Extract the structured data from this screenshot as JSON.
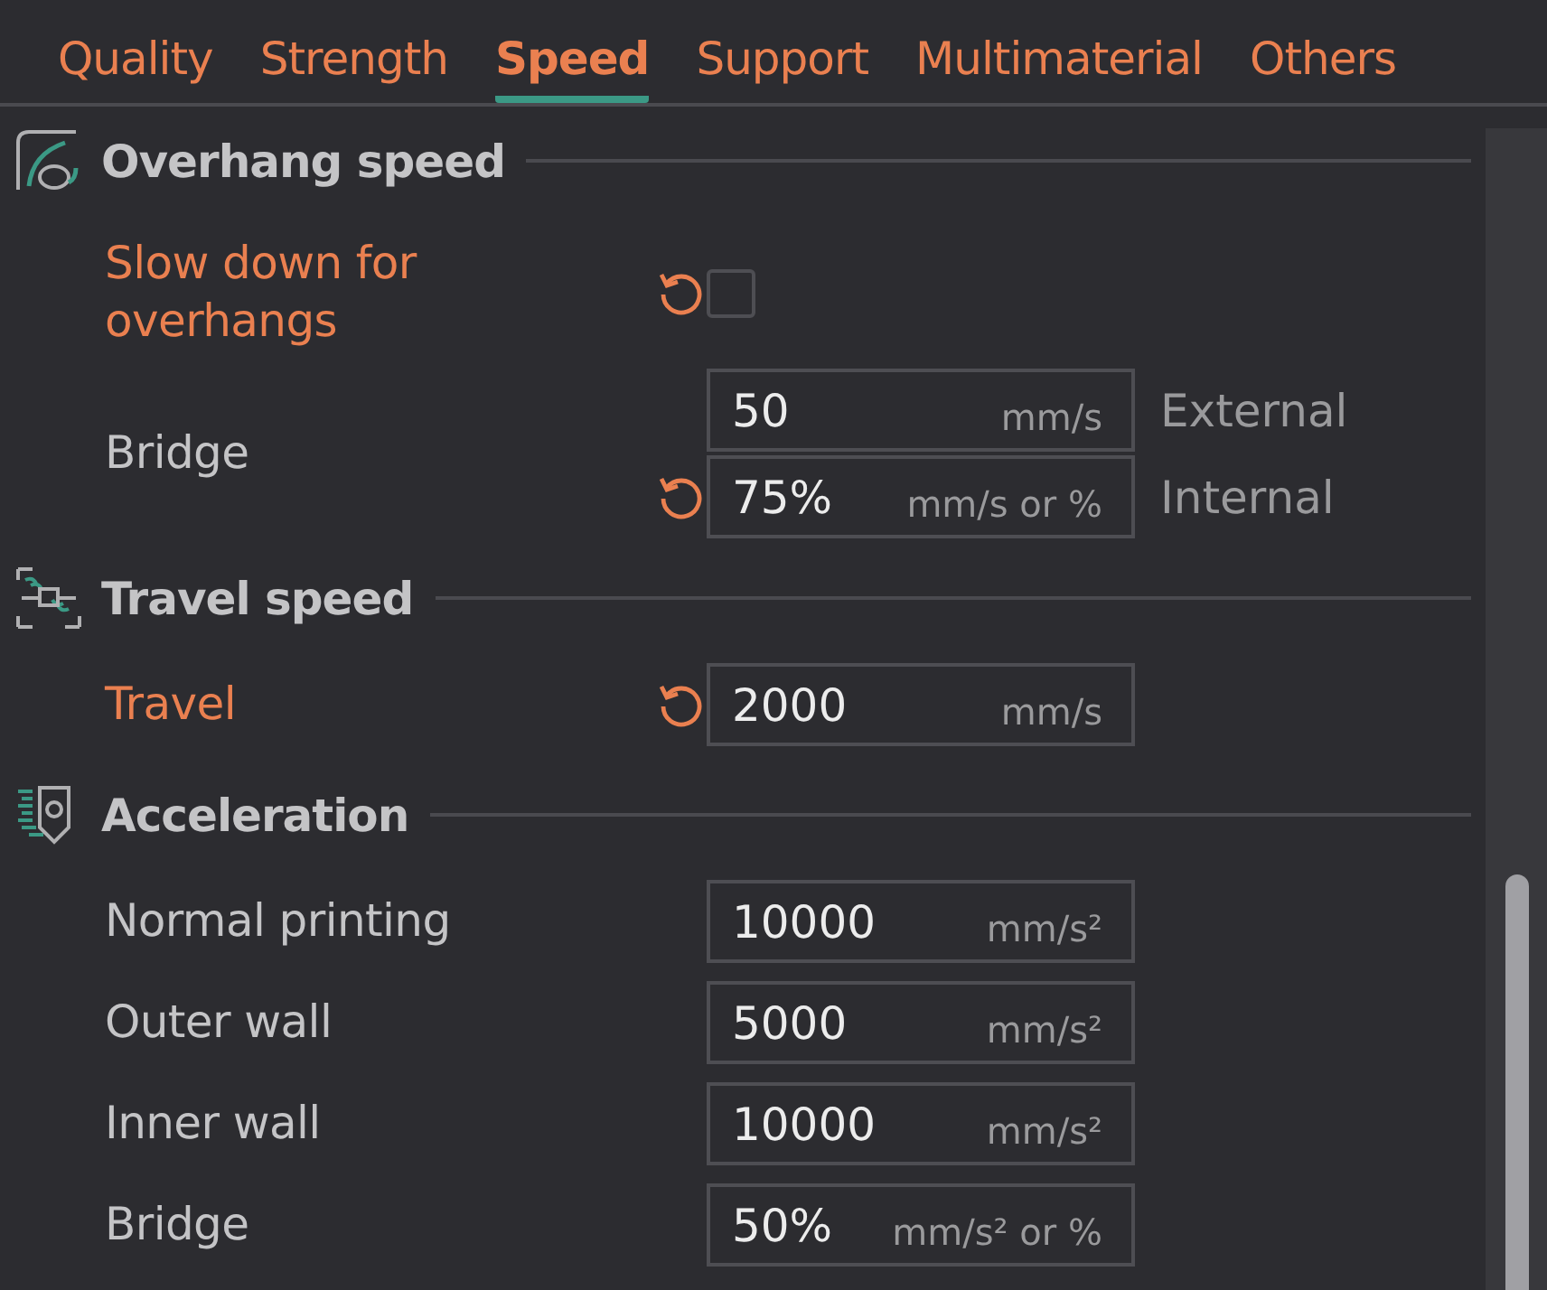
{
  "tabs": [
    {
      "label": "Quality",
      "selected": false
    },
    {
      "label": "Strength",
      "selected": false
    },
    {
      "label": "Speed",
      "selected": true
    },
    {
      "label": "Support",
      "selected": false
    },
    {
      "label": "Multimaterial",
      "selected": false
    },
    {
      "label": "Others",
      "selected": false
    }
  ],
  "sections": [
    {
      "title": "Overhang speed",
      "rows": [
        {
          "kind": "checkbox",
          "label": "Slow down for overhangs",
          "modified": true,
          "reset": true,
          "checked": false
        },
        {
          "kind": "inputs",
          "label": "Bridge",
          "modified": false,
          "fields": [
            {
              "value": "50",
              "unit": "mm/s",
              "side": "External",
              "reset": false
            },
            {
              "value": "75%",
              "unit": "mm/s or %",
              "side": "Internal",
              "reset": true
            }
          ]
        }
      ]
    },
    {
      "title": "Travel speed",
      "rows": [
        {
          "kind": "inputs",
          "label": "Travel",
          "modified": true,
          "fields": [
            {
              "value": "2000",
              "unit": "mm/s",
              "reset": true
            }
          ]
        }
      ]
    },
    {
      "title": "Acceleration",
      "rows": [
        {
          "kind": "inputs",
          "label": "Normal printing",
          "modified": false,
          "fields": [
            {
              "value": "10000",
              "unit": "mm/s²",
              "reset": false
            }
          ]
        },
        {
          "kind": "inputs",
          "label": "Outer wall",
          "modified": false,
          "fields": [
            {
              "value": "5000",
              "unit": "mm/s²",
              "reset": false
            }
          ]
        },
        {
          "kind": "inputs",
          "label": "Inner wall",
          "modified": false,
          "fields": [
            {
              "value": "10000",
              "unit": "mm/s²",
              "reset": false
            }
          ]
        },
        {
          "kind": "inputs",
          "label": "Bridge",
          "modified": false,
          "fields": [
            {
              "value": "50%",
              "unit": "mm/s² or %",
              "reset": false
            }
          ]
        }
      ]
    }
  ]
}
